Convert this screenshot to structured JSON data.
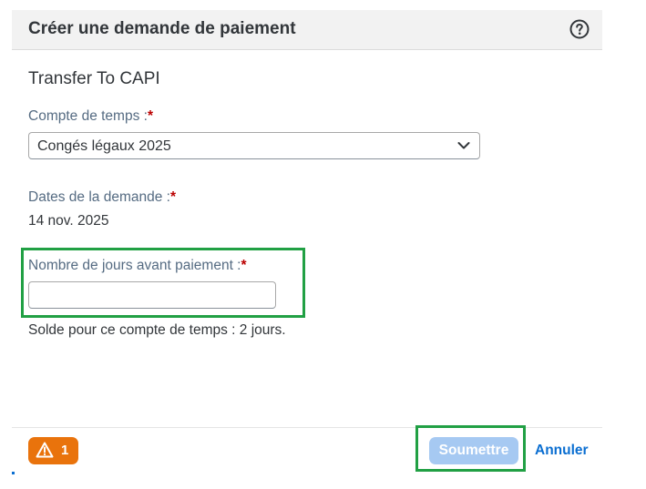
{
  "dialog": {
    "title": "Créer une demande de paiement",
    "subtitle": "Transfer To CAPI"
  },
  "fields": {
    "time_account_label": "Compte de temps :",
    "time_account_value": "Congés légaux 2025",
    "request_dates_label": "Dates de la demande :",
    "request_dates_value": "14 nov. 2025",
    "days_label": "Nombre de jours avant paiement :",
    "days_value": "",
    "required_marker": "*",
    "balance_text": "Solde pour ce compte de temps : 2 jours."
  },
  "footer": {
    "warning_count": "1",
    "submit_label": "Soumettre",
    "cancel_label": "Annuler"
  },
  "icons": {
    "help": "help-icon",
    "dropdown": "chevron-down-icon",
    "warning": "warning-icon"
  },
  "colors": {
    "header_bg": "#f2f2f2",
    "label": "#556b82",
    "required": "#bb0000",
    "highlight": "#21a044",
    "warning": "#e9730c",
    "submit_disabled": "#a6c9f2",
    "link": "#0a6ed1"
  }
}
